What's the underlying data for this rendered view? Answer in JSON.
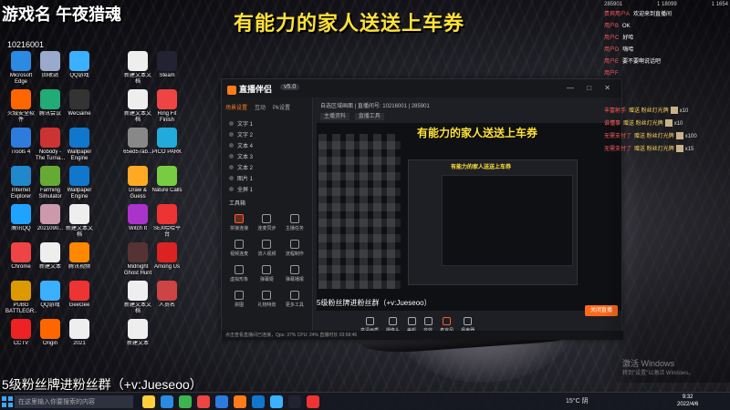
{
  "stream_title": "有能力的家人送送上车券",
  "overlay": {
    "top_text": "游戏名 午夜猎魂",
    "id_text": "10216001",
    "bottom_text": "5级粉丝牌进粉丝群（+v:Jueseoo）",
    "corner_text": "18"
  },
  "desktop_icons": [
    {
      "label": "Microsoft Edge",
      "color": "#2b8be3"
    },
    {
      "label": "回收站",
      "color": "#9ac"
    },
    {
      "label": "QQ游戏",
      "color": "#3ab0ff"
    },
    {
      "label": "新建文本文档",
      "color": "#eee"
    },
    {
      "label": "Steam",
      "color": "#223"
    },
    {
      "label": "火绒安全软件",
      "color": "#f60"
    },
    {
      "label": "腾讯会议",
      "color": "#2a7"
    },
    {
      "label": "WeGame",
      "color": "#333"
    },
    {
      "label": "新建文本文档",
      "color": "#eee"
    },
    {
      "label": "Ring Fit Finish",
      "color": "#e44"
    },
    {
      "label": "iTools 4",
      "color": "#2d7bdc"
    },
    {
      "label": "Nobody - The Turna...",
      "color": "#c33"
    },
    {
      "label": "Wallpaper Engine",
      "color": "#17c"
    },
    {
      "label": "65ed57ab...",
      "color": "#888"
    },
    {
      "label": "PICO PARK",
      "color": "#2ad"
    },
    {
      "label": "Internet Explorer",
      "color": "#28c"
    },
    {
      "label": "Farming Simulator",
      "color": "#6a3"
    },
    {
      "label": "Wallpaper Engine",
      "color": "#17c"
    },
    {
      "label": "Draw & Guess",
      "color": "#fa2"
    },
    {
      "label": "Nature Calls",
      "color": "#7c4"
    },
    {
      "label": "腾讯QQ",
      "color": "#1fa3ff"
    },
    {
      "label": "2021090...",
      "color": "#c9a"
    },
    {
      "label": "新建文本文档",
      "color": "#eee"
    },
    {
      "label": "Witch It",
      "color": "#a3c"
    },
    {
      "label": "SEX哈哈平台",
      "color": "#e33"
    },
    {
      "label": "Chrome",
      "color": "#e44"
    },
    {
      "label": "新建文本",
      "color": "#eee"
    },
    {
      "label": "腾讯视频",
      "color": "#f80"
    },
    {
      "label": "Midnight Ghost Hunt",
      "color": "#533"
    },
    {
      "label": "Among Us",
      "color": "#d22"
    },
    {
      "label": "PUBG BATTLEGR...",
      "color": "#d90"
    },
    {
      "label": "QQ游戏",
      "color": "#3ab0ff"
    },
    {
      "label": "GeeGee",
      "color": "#e33"
    },
    {
      "label": "新建文本文档",
      "color": "#eee"
    },
    {
      "label": "人员名",
      "color": "#c44"
    },
    {
      "label": "CCTV",
      "color": "#e22"
    },
    {
      "label": "Origin",
      "color": "#f60"
    },
    {
      "label": "2021",
      "color": "#eee"
    },
    {
      "label": "新建文本",
      "color": "#eee"
    }
  ],
  "obs": {
    "app_name": "直播伴侣",
    "version": "v5.0",
    "left_tabs": [
      "场景设置",
      "互动",
      "Pk设置"
    ],
    "scenes": [
      "文字 1",
      "文字 2",
      "文本 4",
      "文本 3",
      "文本 2",
      "图片 1",
      "全屏 1"
    ],
    "toolbox_title": "工具箱",
    "tools": [
      "拼接连接",
      "连麦同步",
      "主播任务",
      "视频连麦",
      "流人视频",
      "流程制作",
      "虚拟形象",
      "弹幕姬",
      "弹幕播报",
      "拼图",
      "礼物特效",
      "更多工具"
    ],
    "main_top": "自选区域画面 | 直播间号: 10216001 | 285901",
    "sub_tabs": [
      "主播资料",
      "直播工具"
    ],
    "bottom_controls": [
      "高清画质",
      "摄像头",
      "美颜",
      "音效",
      "麦克风",
      "扬声器"
    ],
    "go_live": "关闭直播",
    "status_bar": "点击查看直播间已连接，Qpu: 37%   CPU: 24%   直播时长 03:58:46"
  },
  "chat": {
    "header": [
      "285901",
      "1 18099",
      "1 1654"
    ],
    "lines": [
      {
        "user": "贵宾用户A",
        "msg": "欢迎来到直播间"
      },
      {
        "user": "用户B",
        "msg": "OK"
      },
      {
        "user": "用户C",
        "msg": "好哈"
      },
      {
        "user": "用户D",
        "msg": "嗨哈"
      },
      {
        "user": "用户E",
        "msg": "要不要啊说话吧"
      },
      {
        "user": "用户F",
        "msg": ""
      }
    ],
    "gifts": [
      {
        "user": "丰富射手",
        "gift": "赠送 粉丝灯光牌",
        "count": "x10"
      },
      {
        "user": "谁懂事",
        "gift": "赠送 粉丝灯光牌",
        "count": "x10"
      },
      {
        "user": "无需支付了",
        "gift": "赠送 粉丝灯光牌",
        "count": "x100"
      },
      {
        "user": "无需支付了",
        "gift": "赠送 粉丝灯光牌",
        "count": "x15"
      }
    ]
  },
  "watermark": {
    "title": "激活 Windows",
    "sub": "转到\"设置\"以激活 Windows。"
  },
  "taskbar": {
    "search_placeholder": "在这里输入你要搜索的内容",
    "tray_text": "15°C 阴",
    "time": "9:32",
    "date": "2022/4/6",
    "app_colors": [
      "#ffcf3a",
      "#2b8be3",
      "#3fb34f",
      "#e44",
      "#2d7bdc",
      "#ff7a1a",
      "#17c",
      "#3ab0ff",
      "#223",
      "#e33"
    ]
  }
}
